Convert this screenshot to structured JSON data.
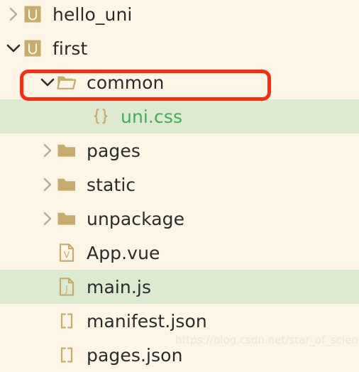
{
  "panel": {
    "name": "project-file-tree",
    "background_color": "#fdf6e6",
    "selected_row_color": "#dceacf",
    "highlight_color": "#fb2a10",
    "text_color": "#2b2b2b",
    "accent_color": "#c6ab6a",
    "css_file_color": "#3fae5a"
  },
  "rows": [
    {
      "label": "hello_uni",
      "icon": "uniapp-project-icon",
      "chevron": "chevron-right-icon",
      "expanded": false,
      "indent": 0,
      "selected": false,
      "highlighted": false,
      "type": "project"
    },
    {
      "label": "first",
      "icon": "uniapp-project-icon",
      "chevron": "chevron-down-icon",
      "expanded": true,
      "indent": 0,
      "selected": false,
      "highlighted": false,
      "type": "project"
    },
    {
      "label": "common",
      "icon": "folder-open-icon",
      "chevron": "chevron-down-icon",
      "expanded": true,
      "indent": 1,
      "selected": false,
      "highlighted": true,
      "type": "folder"
    },
    {
      "label": "uni.css",
      "icon": "css-braces-icon",
      "chevron": "",
      "expanded": false,
      "indent": 2,
      "selected": true,
      "highlighted": false,
      "type": "file-css"
    },
    {
      "label": "pages",
      "icon": "folder-closed-icon",
      "chevron": "chevron-right-icon",
      "expanded": false,
      "indent": 1,
      "selected": false,
      "highlighted": false,
      "type": "folder"
    },
    {
      "label": "static",
      "icon": "folder-closed-icon",
      "chevron": "chevron-right-icon",
      "expanded": false,
      "indent": 1,
      "selected": false,
      "highlighted": false,
      "type": "folder"
    },
    {
      "label": "unpackage",
      "icon": "folder-closed-icon",
      "chevron": "chevron-right-icon",
      "expanded": false,
      "indent": 1,
      "selected": false,
      "highlighted": false,
      "type": "folder"
    },
    {
      "label": "App.vue",
      "icon": "vue-file-icon",
      "chevron": "",
      "expanded": false,
      "indent": 1,
      "selected": false,
      "highlighted": false,
      "type": "file-vue"
    },
    {
      "label": "main.js",
      "icon": "js-file-icon",
      "chevron": "",
      "expanded": false,
      "indent": 1,
      "selected": true,
      "highlighted": false,
      "type": "file-js"
    },
    {
      "label": "manifest.json",
      "icon": "json-brackets-icon",
      "chevron": "",
      "expanded": false,
      "indent": 1,
      "selected": false,
      "highlighted": false,
      "type": "file-json"
    },
    {
      "label": "pages.json",
      "icon": "json-brackets-icon",
      "chevron": "",
      "expanded": false,
      "indent": 1,
      "selected": false,
      "highlighted": false,
      "type": "file-json"
    }
  ],
  "watermark": {
    "text": "https://blog.csdn.net/star_of_science"
  }
}
